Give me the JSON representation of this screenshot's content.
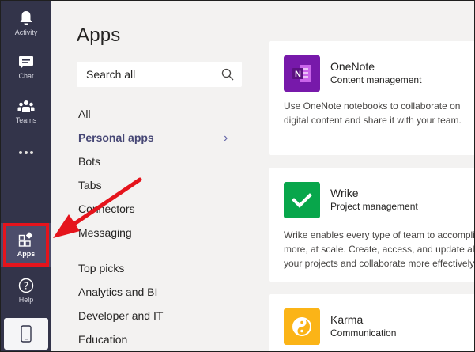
{
  "rail": {
    "items": [
      {
        "label": "Activity",
        "icon": "bell-icon"
      },
      {
        "label": "Chat",
        "icon": "chat-icon"
      },
      {
        "label": "Teams",
        "icon": "teams-icon"
      },
      {
        "label": "",
        "icon": "more-icon"
      },
      {
        "label": "Apps",
        "icon": "apps-icon"
      },
      {
        "label": "Help",
        "icon": "help-icon"
      },
      {
        "label": "",
        "icon": "phone-icon"
      }
    ],
    "highlight_color": "#e5141c",
    "background": "#33344a"
  },
  "main": {
    "title": "Apps",
    "search": {
      "placeholder": "Search all"
    },
    "nav": {
      "items": [
        "All",
        "Personal apps",
        "Bots",
        "Tabs",
        "Connectors",
        "Messaging"
      ],
      "selected": "Personal apps",
      "categories": [
        "Top picks",
        "Analytics and BI",
        "Developer and IT",
        "Education"
      ]
    }
  },
  "apps": [
    {
      "name": "OneNote",
      "category": "Content management",
      "description_lines": [
        "Use OneNote notebooks to collaborate on",
        "digital content and share it with your team."
      ],
      "icon": "onenote-icon",
      "color": "#7719aa"
    },
    {
      "name": "Wrike",
      "category": "Project management",
      "description_lines": [
        "Wrike enables every type of team to accomplis",
        "more, at scale. Create, access, and update all",
        "your projects and collaborate more effectively"
      ],
      "icon": "wrike-icon",
      "color": "#08a64b"
    },
    {
      "name": "Karma",
      "category": "Communication",
      "description_lines": [],
      "icon": "karma-icon",
      "color": "#fbb417"
    }
  ]
}
